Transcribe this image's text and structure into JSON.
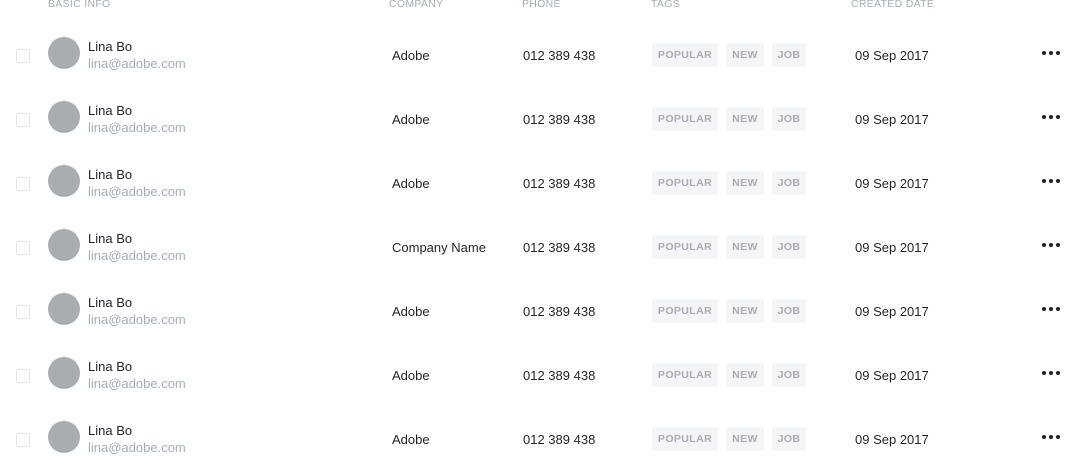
{
  "table": {
    "columns": {
      "basic_info": "BASIC INFO",
      "company": "COMPANY",
      "phone": "PHONE",
      "tags": "TAGS",
      "created_date": "CREATED DATE"
    },
    "rows": [
      {
        "name": "Lina Bo",
        "email": "lina@adobe.com",
        "company": "Adobe",
        "phone": "012 389 438",
        "tags": [
          "POPULAR",
          "NEW",
          "JOB"
        ],
        "date": "09 Sep 2017"
      },
      {
        "name": "Lina Bo",
        "email": "lina@adobe.com",
        "company": "Adobe",
        "phone": "012 389 438",
        "tags": [
          "POPULAR",
          "NEW",
          "JOB"
        ],
        "date": "09 Sep 2017"
      },
      {
        "name": "Lina Bo",
        "email": "lina@adobe.com",
        "company": "Adobe",
        "phone": "012 389 438",
        "tags": [
          "POPULAR",
          "NEW",
          "JOB"
        ],
        "date": "09 Sep 2017"
      },
      {
        "name": "Lina Bo",
        "email": "lina@adobe.com",
        "company": "Company Name",
        "phone": "012 389 438",
        "tags": [
          "POPULAR",
          "NEW",
          "JOB"
        ],
        "date": "09 Sep 2017"
      },
      {
        "name": "Lina Bo",
        "email": "lina@adobe.com",
        "company": "Adobe",
        "phone": "012 389 438",
        "tags": [
          "POPULAR",
          "NEW",
          "JOB"
        ],
        "date": "09 Sep 2017"
      },
      {
        "name": "Lina Bo",
        "email": "lina@adobe.com",
        "company": "Adobe",
        "phone": "012 389 438",
        "tags": [
          "POPULAR",
          "NEW",
          "JOB"
        ],
        "date": "09 Sep 2017"
      },
      {
        "name": "Lina Bo",
        "email": "lina@adobe.com",
        "company": "Adobe",
        "phone": "012 389 438",
        "tags": [
          "POPULAR",
          "NEW",
          "JOB"
        ],
        "date": "09 Sep 2017"
      }
    ]
  },
  "icons": {
    "row_menu": "more-horizontal-icon"
  },
  "colors": {
    "primary_text": "#1f2329",
    "muted_text": "#a7adb6",
    "avatar": "#a9acb1",
    "tag_background": "#f4f5f7"
  }
}
